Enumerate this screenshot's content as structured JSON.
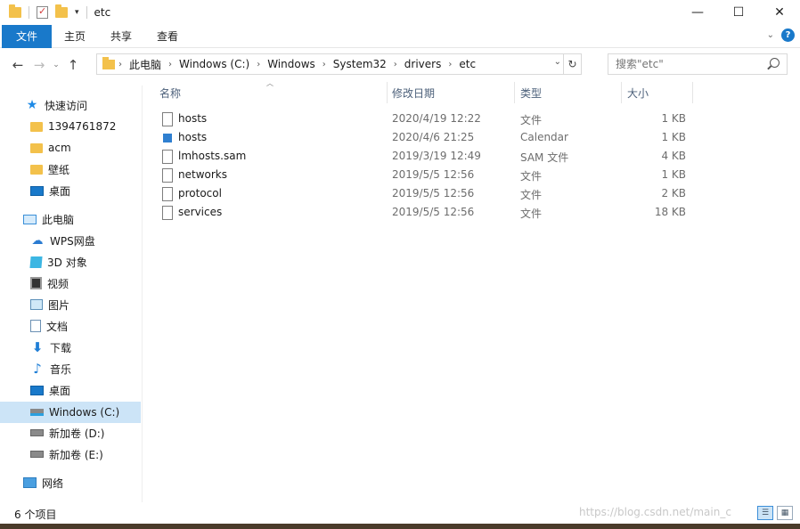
{
  "window": {
    "title": "etc",
    "controls": {
      "minimize": "—",
      "maximize": "☐",
      "close": "✕"
    }
  },
  "ribbon": {
    "tabs": [
      {
        "label": "文件",
        "active": true
      },
      {
        "label": "主页"
      },
      {
        "label": "共享"
      },
      {
        "label": "查看"
      }
    ],
    "accent": "#1979ca"
  },
  "address": {
    "crumbs": [
      "此电脑",
      "Windows (C:)",
      "Windows",
      "System32",
      "drivers",
      "etc"
    ],
    "search_placeholder": "搜索\"etc\""
  },
  "sidebar": {
    "items": [
      {
        "label": "快速访问",
        "icon": "star-icon"
      },
      {
        "label": "1394761872",
        "icon": "folder-icon"
      },
      {
        "label": "acm",
        "icon": "folder-icon"
      },
      {
        "label": "壁纸",
        "icon": "folder-icon"
      },
      {
        "label": "桌面",
        "icon": "desktop-icon"
      },
      {
        "label": "此电脑",
        "icon": "pc-icon"
      },
      {
        "label": "WPS网盘",
        "icon": "cloud-icon"
      },
      {
        "label": "3D 对象",
        "icon": "cube-icon"
      },
      {
        "label": "视频",
        "icon": "video-icon"
      },
      {
        "label": "图片",
        "icon": "picture-icon"
      },
      {
        "label": "文档",
        "icon": "document-icon"
      },
      {
        "label": "下载",
        "icon": "download-icon"
      },
      {
        "label": "音乐",
        "icon": "music-icon"
      },
      {
        "label": "桌面",
        "icon": "desktop-icon"
      },
      {
        "label": "Windows (C:)",
        "icon": "drive-c-icon",
        "selected": true
      },
      {
        "label": "新加卷 (D:)",
        "icon": "drive-icon"
      },
      {
        "label": "新加卷 (E:)",
        "icon": "drive-icon"
      },
      {
        "label": "网络",
        "icon": "network-icon"
      }
    ]
  },
  "columns": {
    "name": "名称",
    "date": "修改日期",
    "type": "类型",
    "size": "大小"
  },
  "files": [
    {
      "name": "hosts",
      "date": "2020/4/19 12:22",
      "type": "文件",
      "size": "1 KB",
      "icon": "file-icon"
    },
    {
      "name": "hosts",
      "date": "2020/4/6 21:25",
      "type": "Calendar",
      "size": "1 KB",
      "icon": "calendar-file-icon"
    },
    {
      "name": "lmhosts.sam",
      "date": "2019/3/19 12:49",
      "type": "SAM 文件",
      "size": "4 KB",
      "icon": "file-icon"
    },
    {
      "name": "networks",
      "date": "2019/5/5 12:56",
      "type": "文件",
      "size": "1 KB",
      "icon": "file-icon"
    },
    {
      "name": "protocol",
      "date": "2019/5/5 12:56",
      "type": "文件",
      "size": "2 KB",
      "icon": "file-icon"
    },
    {
      "name": "services",
      "date": "2019/5/5 12:56",
      "type": "文件",
      "size": "18 KB",
      "icon": "file-icon"
    }
  ],
  "status": {
    "count": "6 个项目"
  },
  "watermark": "https://blog.csdn.net/main_c"
}
